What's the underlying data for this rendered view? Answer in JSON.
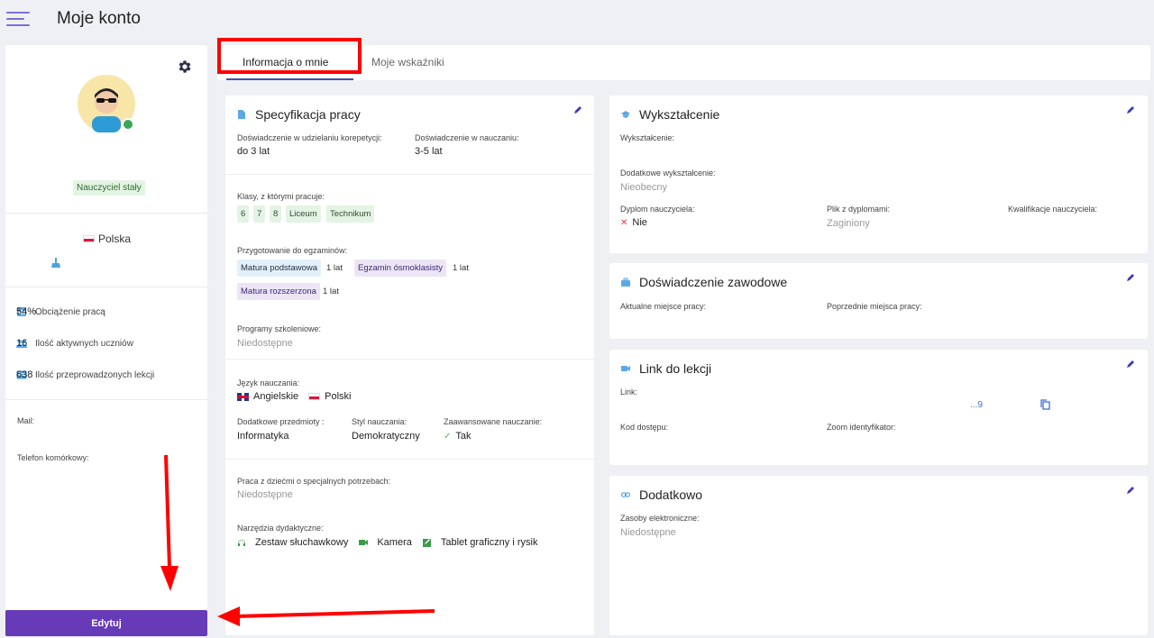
{
  "header": {
    "title": "Moje konto"
  },
  "sidebar": {
    "role_badge": "Nauczyciel stały",
    "country": "Polska",
    "stats": [
      {
        "label": "Obciążenie pracą",
        "value": "54%",
        "icon": "workload-icon"
      },
      {
        "label": "Ilość aktywnych uczniów",
        "value": "16",
        "icon": "students-icon"
      },
      {
        "label": "Ilość przeprowadzonych lekcji",
        "value": "638",
        "icon": "lessons-icon"
      }
    ],
    "mail_label": "Mail:",
    "phone_label": "Telefon komórkowy:",
    "edit_label": "Edytuj"
  },
  "tabs": [
    {
      "label": "Informacja o mnie",
      "active": true
    },
    {
      "label": "Moje wskaźniki",
      "active": false
    }
  ],
  "work_spec": {
    "title": "Specyfikacja pracy",
    "tutoring_exp_label": "Doświadczenie w udzielaniu korepetycji:",
    "tutoring_exp_value": "do 3 lat",
    "teaching_exp_label": "Doświadczenie w nauczaniu:",
    "teaching_exp_value": "3-5 lat",
    "classes_label": "Klasy, z którymi pracuje:",
    "classes": [
      "6",
      "7",
      "8",
      "Liceum",
      "Technikum"
    ],
    "exams_label": "Przygotowanie do egzaminów:",
    "exams": [
      {
        "name": "Matura podstawowa",
        "years": "1 lat"
      },
      {
        "name": "Egzamin ósmoklasisty",
        "years": "1 lat"
      },
      {
        "name": "Matura rozszerzona",
        "years": "1 lat"
      }
    ],
    "programs_label": "Programy szkoleniowe:",
    "programs_value": "Niedostępne",
    "language_label": "Język nauczania:",
    "languages": [
      "Angielskie",
      "Polski"
    ],
    "extra_subjects_label": "Dodatkowe przedmioty :",
    "extra_subjects_value": "Informatyka",
    "style_label": "Styl nauczania:",
    "style_value": "Demokratyczny",
    "advanced_label": "Zaawansowane nauczanie:",
    "advanced_value": "Tak",
    "special_needs_label": "Praca z dziećmi o specjalnych potrzebach:",
    "special_needs_value": "Niedostępne",
    "tools_label": "Narzędzia dydaktyczne:",
    "tools": [
      "Zestaw słuchawkowy",
      "Kamera",
      "Tablet graficzny i rysik"
    ]
  },
  "education": {
    "title": "Wykształcenie",
    "education_label": "Wykształcenie:",
    "additional_label": "Dodatkowe wykształcenie:",
    "additional_value": "Nieobecny",
    "diploma_label": "Dyplom nauczyciela:",
    "diploma_value": "Nie",
    "diploma_file_label": "Plik z dyplomami:",
    "diploma_file_value": "Zaginiony",
    "qualifications_label": "Kwalifikacje nauczyciela:"
  },
  "experience": {
    "title": "Doświadczenie zawodowe",
    "current_label": "Aktualne miejsce pracy:",
    "previous_label": "Poprzednie miejsca pracy:"
  },
  "lesson_link": {
    "title": "Link do lekcji",
    "link_label": "Link:",
    "link_value": "...9",
    "access_code_label": "Kod dostępu:",
    "zoom_id_label": "Zoom identyfikator:"
  },
  "additional": {
    "title": "Dodatkowo",
    "resources_label": "Zasoby elektroniczne:",
    "resources_value": "Niedostępne"
  },
  "colors": {
    "accent": "#673ab7",
    "tab_underline": "#3f51b5",
    "annotation_red": "#ff0000",
    "chip_green": "#e4f4e4",
    "chip_blue": "#e3f0fa",
    "chip_purple": "#ebe5f5"
  }
}
